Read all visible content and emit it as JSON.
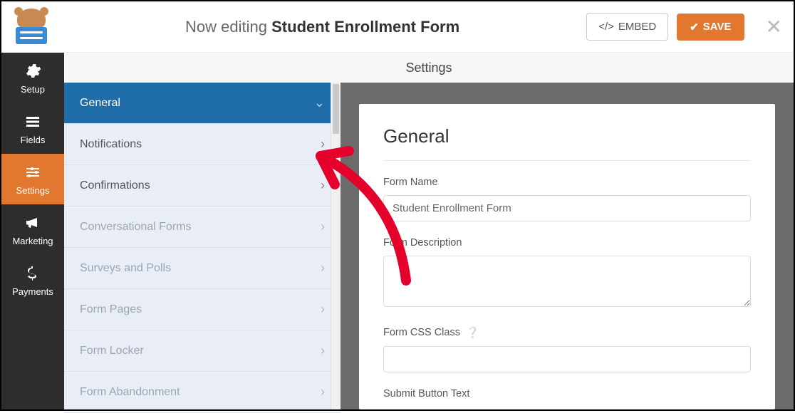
{
  "header": {
    "editing_prefix": "Now editing ",
    "form_title": "Student Enrollment Form",
    "embed_label": "EMBED",
    "save_label": "SAVE"
  },
  "leftnav": {
    "items": [
      {
        "label": "Setup"
      },
      {
        "label": "Fields"
      },
      {
        "label": "Settings"
      },
      {
        "label": "Marketing"
      },
      {
        "label": "Payments"
      }
    ]
  },
  "panel_title": "Settings",
  "tabs": [
    {
      "label": "General",
      "state": "active"
    },
    {
      "label": "Notifications",
      "state": ""
    },
    {
      "label": "Confirmations",
      "state": ""
    },
    {
      "label": "Conversational Forms",
      "state": "disabled"
    },
    {
      "label": "Surveys and Polls",
      "state": "disabled"
    },
    {
      "label": "Form Pages",
      "state": "disabled"
    },
    {
      "label": "Form Locker",
      "state": "disabled"
    },
    {
      "label": "Form Abandonment",
      "state": "disabled"
    }
  ],
  "content": {
    "heading": "General",
    "form_name_label": "Form Name",
    "form_name_value": "Student Enrollment Form",
    "form_desc_label": "Form Description",
    "form_desc_value": "",
    "form_css_label": "Form CSS Class",
    "form_css_value": "",
    "submit_btn_label": "Submit Button Text"
  }
}
